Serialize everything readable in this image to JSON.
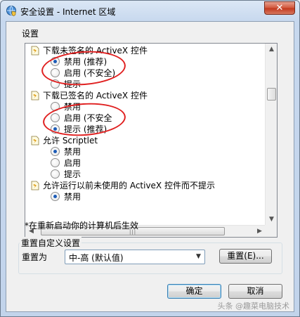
{
  "window": {
    "title": "安全设置 - Internet 区域",
    "close_glyph": "✕"
  },
  "settings_label": "设置",
  "settings_items": [
    {
      "title": "下载未签名的 ActiveX 控件",
      "options": [
        {
          "label": "禁用 (推荐)",
          "selected": true
        },
        {
          "label": "启用 (不安全)",
          "selected": false
        },
        {
          "label": "提示",
          "selected": false
        }
      ]
    },
    {
      "title": "下载已签名的 ActiveX 控件",
      "options": [
        {
          "label": "禁用",
          "selected": false
        },
        {
          "label": "启用 (不安全",
          "selected": false
        },
        {
          "label": "提示 (推荐)",
          "selected": true
        }
      ]
    },
    {
      "title": "允许 Scriptlet",
      "options": [
        {
          "label": "禁用",
          "selected": true
        },
        {
          "label": "启用",
          "selected": false
        },
        {
          "label": "提示",
          "selected": false
        }
      ]
    },
    {
      "title": "允许运行以前未使用的 ActiveX 控件而不提示",
      "options": [
        {
          "label": "禁用",
          "selected": true
        }
      ]
    }
  ],
  "restart_note": "*在重新启动你的计算机后生效",
  "reset_group": {
    "title": "重置自定义设置",
    "reset_to_label": "重置为",
    "selected_level": "中-高 (默认值)",
    "reset_button": "重置(E)..."
  },
  "buttons": {
    "ok": "确定",
    "cancel": "取消"
  },
  "watermark": "头条 @趣菜电脑技术",
  "colors": {
    "annotation_ring": "#e02020",
    "radio_selected": "#1d5cb7"
  }
}
